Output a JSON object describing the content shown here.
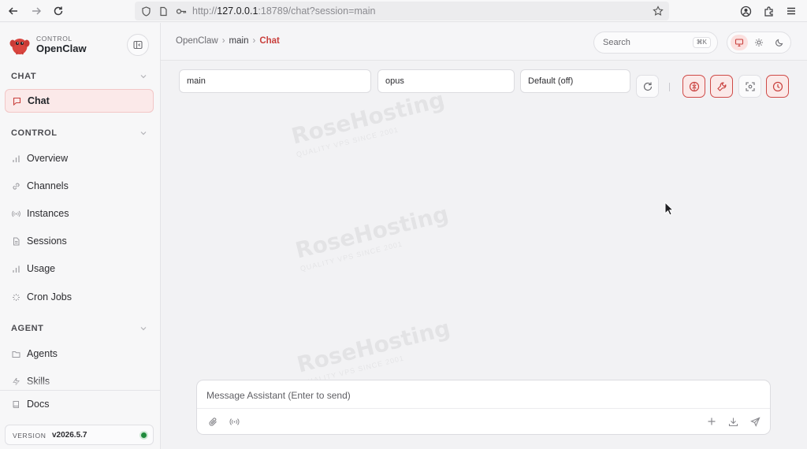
{
  "browser": {
    "url_prefix": "http://",
    "url_host": "127.0.0.1",
    "url_rest": ":18789/chat?session=main",
    "icons": [
      "back-icon",
      "forward-icon",
      "reload-icon",
      "shield-icon",
      "page-icon",
      "key-icon",
      "star-icon",
      "account-icon",
      "extensions-icon",
      "menu-icon"
    ]
  },
  "sidebar": {
    "brand_kicker": "CONTROL",
    "brand_name": "OpenClaw",
    "sections": [
      {
        "label": "CHAT",
        "items": [
          {
            "label": "Chat",
            "icon": "chat-bubble-icon",
            "active": true
          }
        ]
      },
      {
        "label": "CONTROL",
        "items": [
          {
            "label": "Overview",
            "icon": "bar-chart-icon"
          },
          {
            "label": "Channels",
            "icon": "link-icon"
          },
          {
            "label": "Instances",
            "icon": "radio-signal-icon"
          },
          {
            "label": "Sessions",
            "icon": "document-icon"
          },
          {
            "label": "Usage",
            "icon": "bar-chart-icon"
          },
          {
            "label": "Cron Jobs",
            "icon": "loader-icon"
          }
        ]
      },
      {
        "label": "AGENT",
        "items": [
          {
            "label": "Agents",
            "icon": "folder-icon"
          },
          {
            "label": "Skills",
            "icon": "zap-icon"
          }
        ]
      }
    ],
    "docs_label": "Docs",
    "version_label": "VERSION",
    "version_value": "v2026.5.7",
    "status_color": "#1f8a3c"
  },
  "topbar": {
    "breadcrumb": [
      "OpenClaw",
      "main",
      "Chat"
    ],
    "search_placeholder": "Search",
    "search_shortcut": "⌘K",
    "theme_options": [
      "system",
      "light",
      "dark"
    ],
    "theme_selected": "system"
  },
  "controls": {
    "session": "main",
    "model": "opus",
    "thinking": "Default (off)"
  },
  "watermark": {
    "brand": "RoseHosting",
    "tagline": "QUALITY VPS SINCE 2001"
  },
  "composer": {
    "placeholder": "Message Assistant (Enter to send)"
  },
  "colors": {
    "accent": "#c9403d",
    "accent_bg": "#fbe9e8",
    "status_green": "#1f8a3c"
  }
}
